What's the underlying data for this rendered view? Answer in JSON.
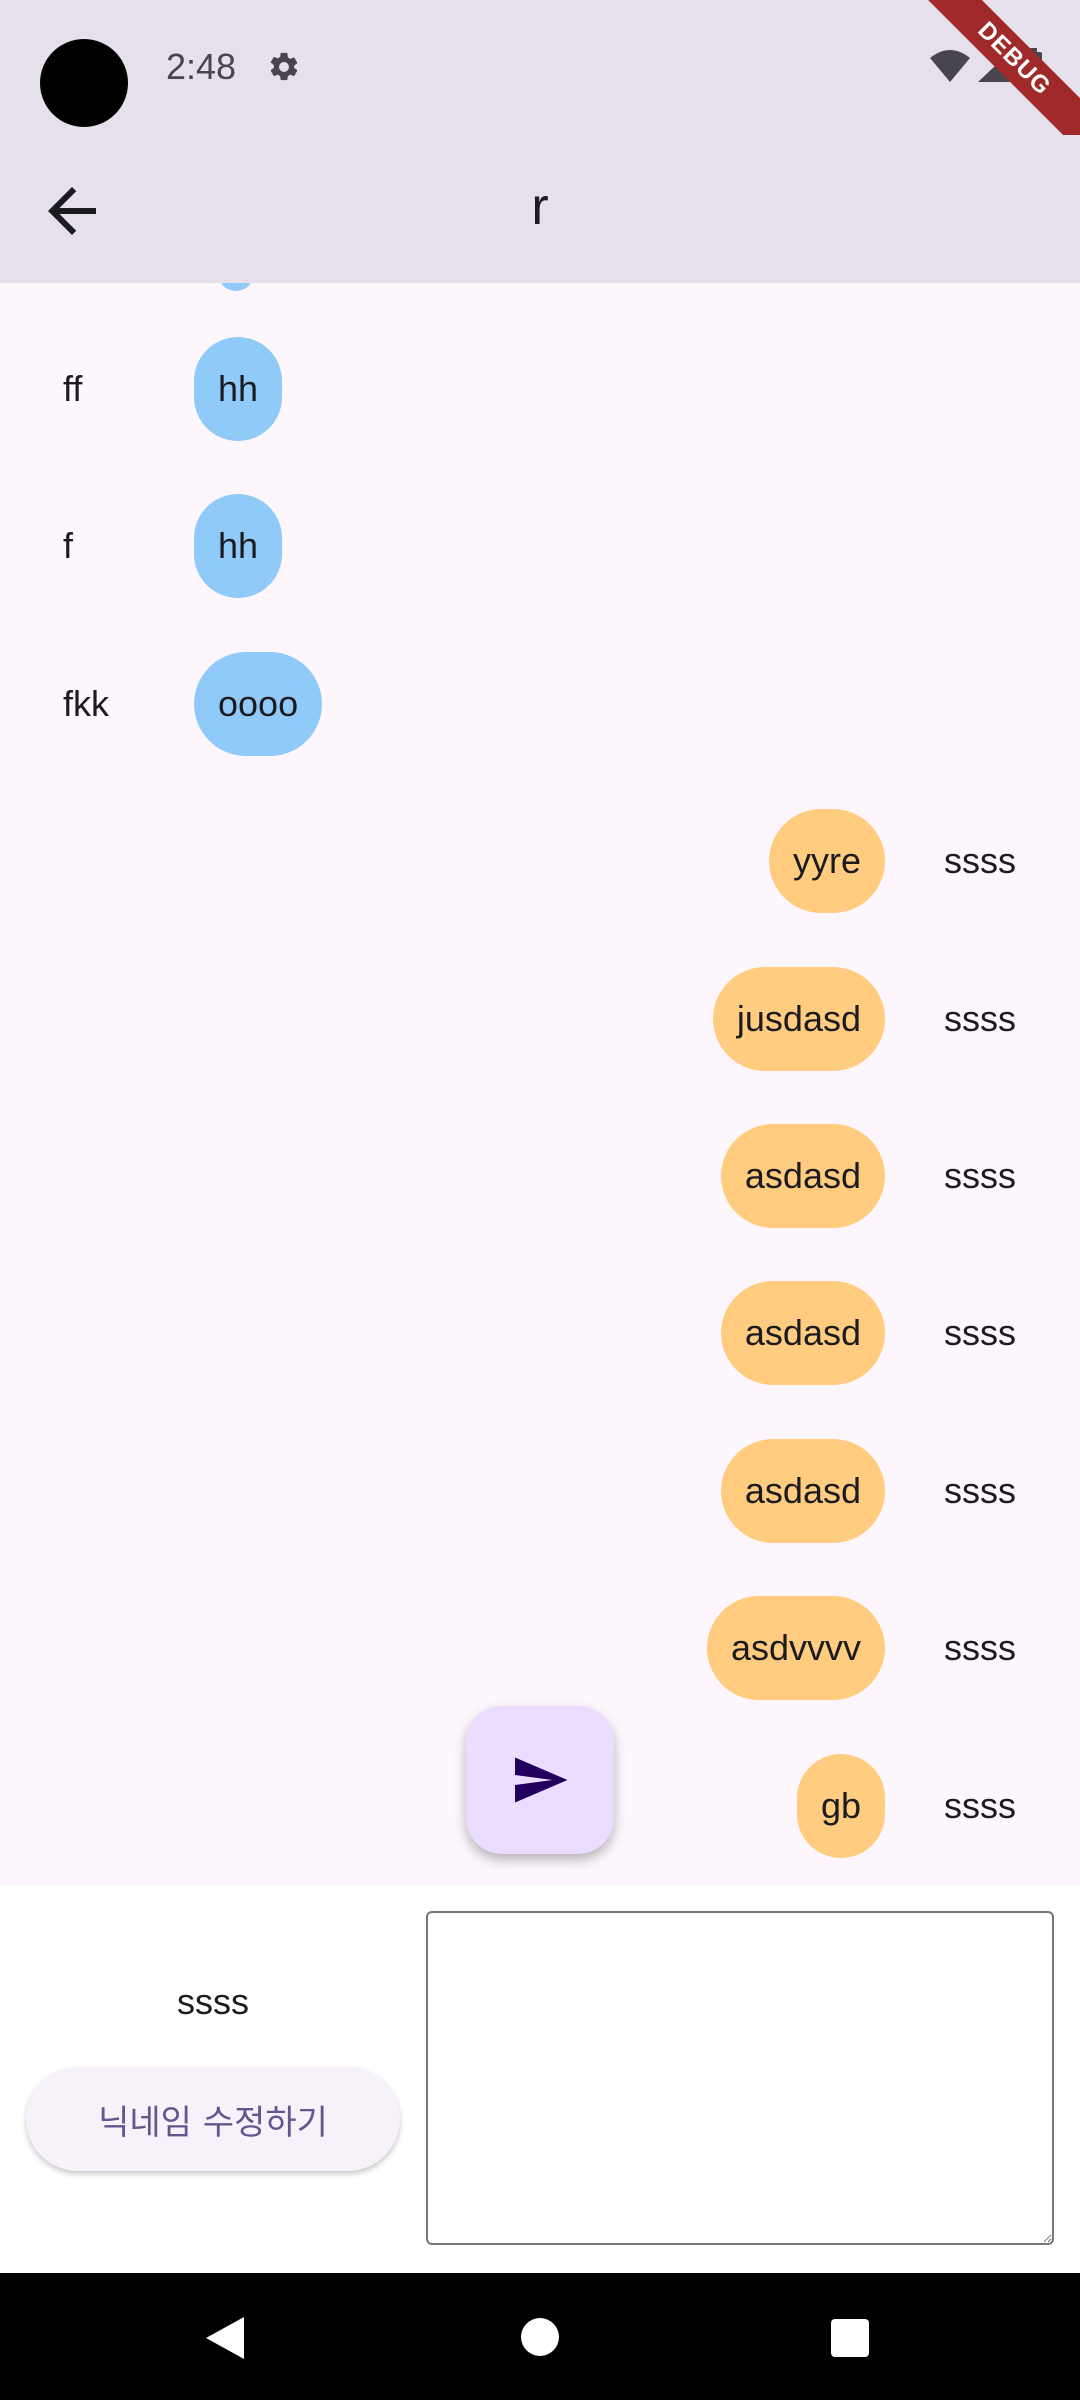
{
  "status": {
    "time": "2:48",
    "debug_label": "DEBUG"
  },
  "app_bar": {
    "title": "r"
  },
  "messages": [
    {
      "side": "left",
      "nick": "ff",
      "text": "hh"
    },
    {
      "side": "left",
      "nick": "f",
      "text": "hh"
    },
    {
      "side": "left",
      "nick": "fkk",
      "text": "oooo"
    },
    {
      "side": "right",
      "nick": "ssss",
      "text": "yyre"
    },
    {
      "side": "right",
      "nick": "ssss",
      "text": "jusdasd"
    },
    {
      "side": "right",
      "nick": "ssss",
      "text": "asdasd"
    },
    {
      "side": "right",
      "nick": "ssss",
      "text": "asdasd"
    },
    {
      "side": "right",
      "nick": "ssss",
      "text": "asdasd"
    },
    {
      "side": "right",
      "nick": "ssss",
      "text": "asdvvvv"
    },
    {
      "side": "right",
      "nick": "ssss",
      "text": "gb"
    }
  ],
  "composer": {
    "my_nickname": "ssss",
    "edit_nickname_label": "닉네임 수정하기",
    "message_value": "",
    "send_icon": "send-icon"
  },
  "colors": {
    "app_bar": "#e6e0ec",
    "left_bubble": "#90caf9",
    "right_bubble": "#ffcc80",
    "fab": "#eaddff"
  }
}
